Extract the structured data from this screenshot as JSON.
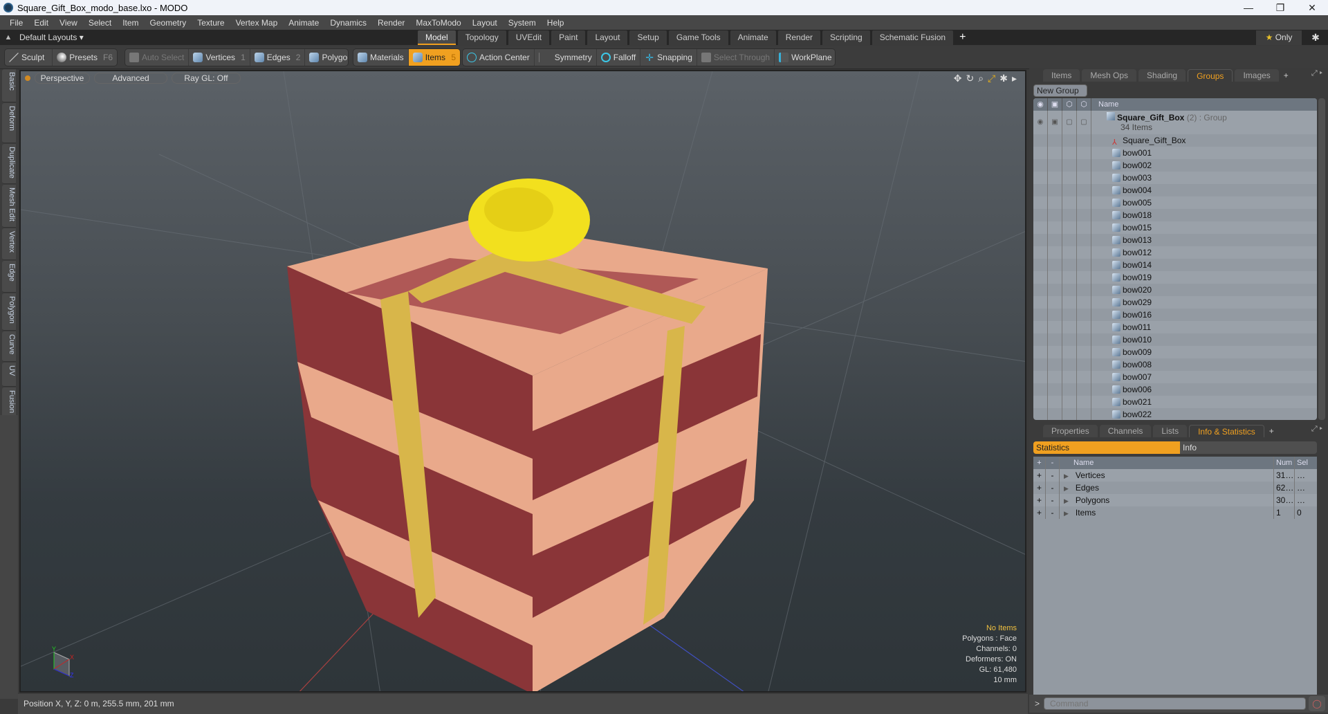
{
  "window": {
    "title": "Square_Gift_Box_modo_base.lxo - MODO",
    "controls": [
      "—",
      "❐",
      "✕"
    ]
  },
  "menu": [
    "File",
    "Edit",
    "View",
    "Select",
    "Item",
    "Geometry",
    "Texture",
    "Vertex Map",
    "Animate",
    "Dynamics",
    "Render",
    "MaxToModo",
    "Layout",
    "System",
    "Help"
  ],
  "layout_bar": {
    "layout_name": "Default Layouts ▾",
    "tabs": [
      "Model",
      "Topology",
      "UVEdit",
      "Paint",
      "Layout",
      "Setup",
      "Game Tools",
      "Animate",
      "Render",
      "Scripting",
      "Schematic Fusion"
    ],
    "active_tab": "Model",
    "add": "+",
    "only_label": "Only",
    "star": "★",
    "gear": "✱"
  },
  "toolbar": {
    "sculpt": "Sculpt",
    "presets": "Presets",
    "presets_key": "F6",
    "auto_select": "Auto Select",
    "vertices": "Vertices",
    "vertices_key": "1",
    "edges": "Edges",
    "edges_key": "2",
    "polygons": "Polygons",
    "materials": "Materials",
    "items": "Items",
    "items_key": "5",
    "action_center": "Action Center",
    "symmetry": "Symmetry",
    "falloff": "Falloff",
    "snapping": "Snapping",
    "select_through": "Select Through",
    "workplane": "WorkPlane"
  },
  "left_tabs": [
    "Basic",
    "Deform",
    "Duplicate",
    "Mesh Edit",
    "Vertex",
    "Edge",
    "Polygon",
    "Curve",
    "UV",
    "Fusion"
  ],
  "viewport": {
    "view": "Perspective",
    "shading": "Advanced",
    "raygl": "Ray GL: Off",
    "info": {
      "selection": "No Items",
      "mode": "Polygons : Face",
      "channels": "Channels: 0",
      "deformers": "Deformers: ON",
      "gl": "GL: 61,480",
      "unit": "10 mm"
    },
    "axis": {
      "x": "X",
      "y": "Y",
      "z": "Z"
    }
  },
  "status": {
    "position": "Position X, Y, Z:   0 m, 255.5 mm, 201 mm"
  },
  "groups_panel": {
    "tabs": [
      "Items",
      "Mesh Ops",
      "Shading",
      "Groups",
      "Images"
    ],
    "active": "Groups",
    "new_group": "New Group",
    "col_name": "Name",
    "group": {
      "name": "Square_Gift_Box",
      "count": "(2)",
      "type": ": Group",
      "sub": "34 Items"
    },
    "items": [
      "Square_Gift_Box",
      "bow001",
      "bow002",
      "bow003",
      "bow004",
      "bow005",
      "bow018",
      "bow015",
      "bow013",
      "bow012",
      "bow014",
      "bow019",
      "bow020",
      "bow029",
      "bow016",
      "bow011",
      "bow010",
      "bow009",
      "bow008",
      "bow007",
      "bow006",
      "bow021",
      "bow022"
    ]
  },
  "info_panel": {
    "tabs": [
      "Properties",
      "Channels",
      "Lists",
      "Info & Statistics"
    ],
    "active": "Info & Statistics",
    "subtabs": [
      "Statistics",
      "Info"
    ],
    "headers": {
      "plus": "+",
      "minus": "-",
      "name": "Name",
      "num": "Num",
      "sel": "Sel"
    },
    "rows": [
      {
        "name": "Vertices",
        "num": "31…",
        "sel": "…"
      },
      {
        "name": "Edges",
        "num": "62…",
        "sel": "…"
      },
      {
        "name": "Polygons",
        "num": "30…",
        "sel": "…"
      },
      {
        "name": "Items",
        "num": "1",
        "sel": "0"
      }
    ]
  },
  "command": {
    "prompt": ">",
    "placeholder": "Command"
  },
  "colors": {
    "accent": "#f0a020",
    "box_light": "#e9a98b",
    "box_dark": "#8a3538",
    "ribbon": "#d8b64a",
    "bow": "#f2e01e"
  }
}
